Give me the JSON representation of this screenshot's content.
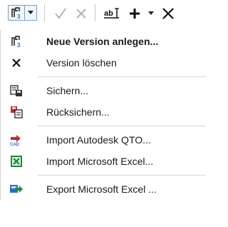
{
  "toolbar": {
    "buttons": [
      {
        "icon": "version-icon"
      },
      {
        "icon": "chevron-down-icon"
      },
      {
        "icon": "check-icon"
      },
      {
        "icon": "close-icon"
      },
      {
        "icon": "rename-text-icon"
      },
      {
        "icon": "plus-icon"
      },
      {
        "icon": "small-dropdown-icon"
      },
      {
        "icon": "close-icon"
      }
    ]
  },
  "menu": {
    "items": [
      {
        "label": "Neue Version anlegen...",
        "icon": "new-version-icon",
        "bold": true
      },
      {
        "label": "Version löschen",
        "icon": "delete-x-icon"
      },
      {
        "label": "Sichern...",
        "icon": "backup-icon"
      },
      {
        "label": "Rücksichern...",
        "icon": "restore-icon"
      },
      {
        "label": "Import Autodesk QTO...",
        "icon": "cad-import-icon"
      },
      {
        "label": "Import Microsoft Excel...",
        "icon": "excel-icon"
      },
      {
        "label": "Export Microsoft Excel ...",
        "icon": "export-arrow-icon"
      }
    ]
  },
  "colors": {
    "accent_blue": "#2b6cc4",
    "excel_green": "#1f8a3d",
    "import_red": "#c62828",
    "border": "#7f9db9"
  }
}
